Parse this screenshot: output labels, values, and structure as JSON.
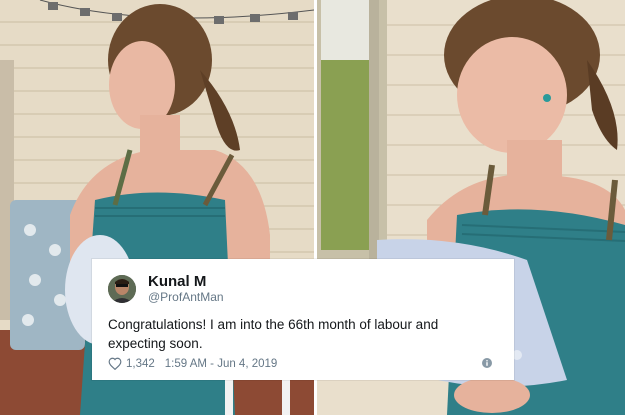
{
  "photos": {
    "left_alt_icon": "photo-left",
    "right_alt_icon": "photo-right"
  },
  "tweet": {
    "display_name": "Kunal M",
    "handle": "@ProfAntMan",
    "text": "Congratulations! I am into the 66th month of labour and expecting soon.",
    "likes": "1,342",
    "timestamp": "1:59 AM - Jun 4, 2019",
    "like_icon": "heart-icon",
    "info_icon": "info-icon"
  },
  "colors": {
    "dress": "#2f7f88",
    "wall": "#e7dcc8",
    "text": "#14171a",
    "meta": "#657786"
  }
}
